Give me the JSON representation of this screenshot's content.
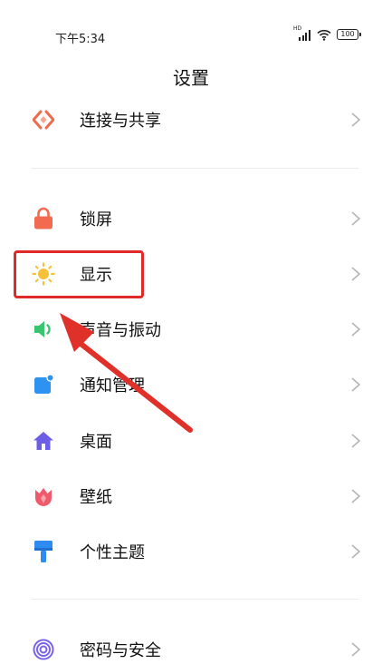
{
  "status_bar": {
    "time": "下午5:34",
    "network_label": "HD",
    "battery_level": "100"
  },
  "header": {
    "title": "设置"
  },
  "settings": {
    "items": [
      {
        "label": "连接与共享",
        "icon": "connection-share-icon",
        "color": "#ee6b4d"
      },
      {
        "label": "锁屏",
        "icon": "lock-icon",
        "color": "#f26a4f"
      },
      {
        "label": "显示",
        "icon": "sun-icon",
        "color": "#f7c23a"
      },
      {
        "label": "声音与振动",
        "icon": "speaker-icon",
        "color": "#39c46f"
      },
      {
        "label": "通知管理",
        "icon": "notification-icon",
        "color": "#2e93f0"
      },
      {
        "label": "桌面",
        "icon": "home-icon",
        "color": "#6d5ee8"
      },
      {
        "label": "壁纸",
        "icon": "tulip-icon",
        "color": "#ee5a6b"
      },
      {
        "label": "个性主题",
        "icon": "paintbrush-icon",
        "color": "#2e8bf0"
      },
      {
        "label": "密码与安全",
        "icon": "fingerprint-icon",
        "color": "#7a63e6"
      }
    ]
  },
  "annotation": {
    "highlighted_item": "显示",
    "color": "#e02a2a"
  }
}
